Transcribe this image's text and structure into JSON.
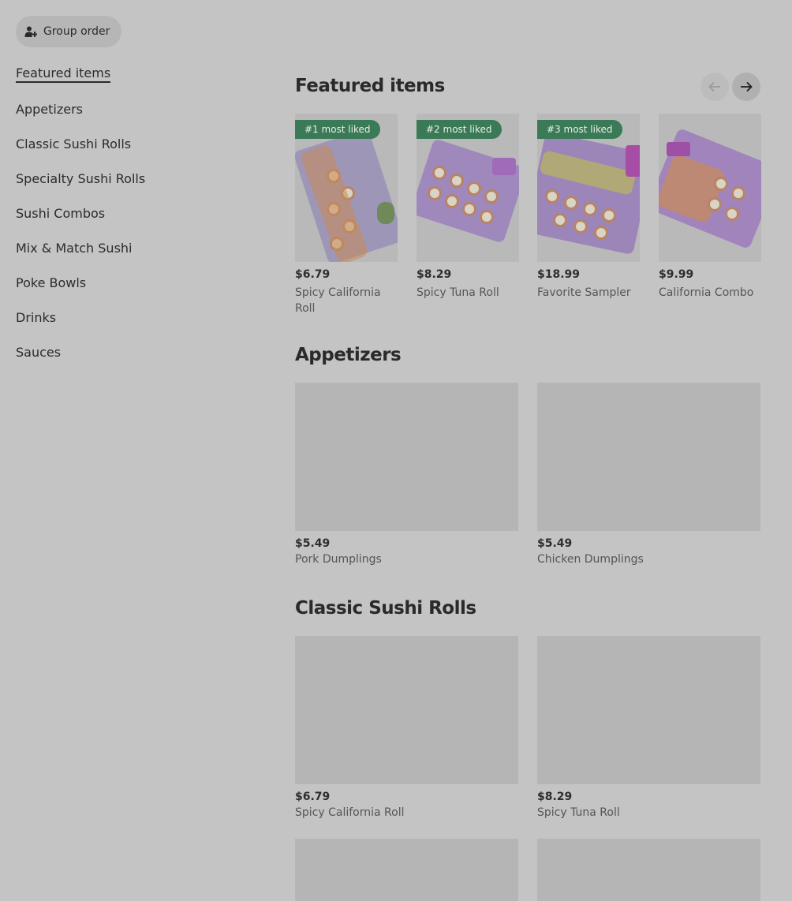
{
  "group_order": {
    "label": "Group order"
  },
  "sidebar": {
    "items": [
      {
        "label": "Featured items"
      },
      {
        "label": "Appetizers"
      },
      {
        "label": "Classic Sushi Rolls"
      },
      {
        "label": "Specialty Sushi Rolls"
      },
      {
        "label": "Sushi Combos"
      },
      {
        "label": "Mix & Match Sushi"
      },
      {
        "label": "Poke Bowls"
      },
      {
        "label": "Drinks"
      },
      {
        "label": "Sauces"
      }
    ]
  },
  "featured": {
    "title": "Featured items",
    "items": [
      {
        "badge": "#1 most liked",
        "price": "$6.79",
        "name": "Spicy California Roll"
      },
      {
        "badge": "#2 most liked",
        "price": "$8.29",
        "name": "Spicy Tuna Roll"
      },
      {
        "badge": "#3 most liked",
        "price": "$18.99",
        "name": "Favorite Sampler"
      },
      {
        "badge": "",
        "price": "$9.99",
        "name": "California Combo"
      }
    ]
  },
  "appetizers": {
    "title": "Appetizers",
    "items": [
      {
        "price": "$5.49",
        "name": "Pork Dumplings"
      },
      {
        "price": "$5.49",
        "name": "Chicken Dumplings"
      }
    ]
  },
  "classic": {
    "title": "Classic Sushi Rolls",
    "items": [
      {
        "price": "$6.79",
        "name": "Spicy California Roll"
      },
      {
        "price": "$8.29",
        "name": "Spicy Tuna Roll"
      }
    ]
  },
  "icons": {
    "group": "person-add-icon",
    "prev": "arrow-left-icon",
    "next": "arrow-right-icon"
  }
}
